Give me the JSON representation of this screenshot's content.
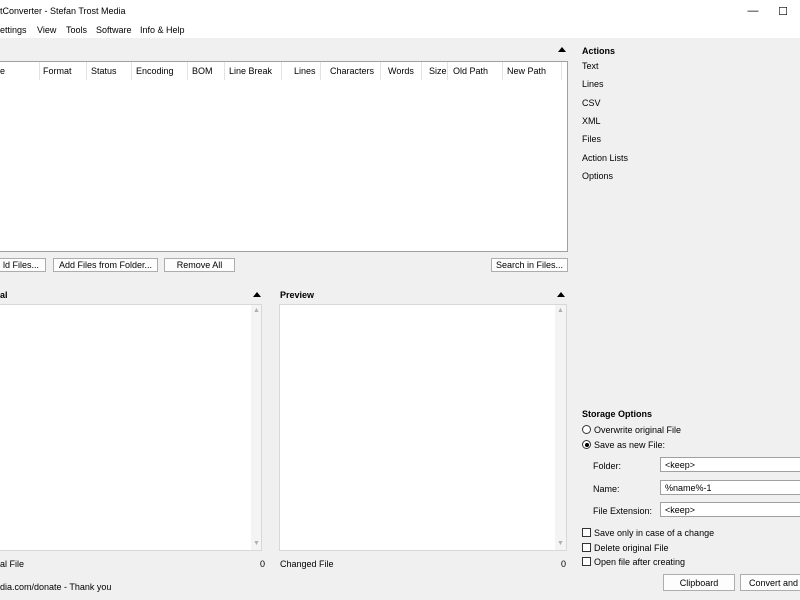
{
  "window": {
    "title": "tConverter - Stefan Trost Media",
    "minimize_icon": "—",
    "maximize_icon": "☐"
  },
  "menu": [
    "ettings",
    "View",
    "Tools",
    "Software",
    "Info & Help"
  ],
  "file_list": {
    "columns": [
      "e",
      "Format",
      "Status",
      "Encoding",
      "BOM",
      "Line Break",
      "Lines",
      "Characters",
      "Words",
      "Size",
      "Old Path",
      "New Path"
    ]
  },
  "file_buttons": {
    "add_files": "ld Files...",
    "add_from_folder": "Add Files from Folder...",
    "remove_all": "Remove All",
    "search_in_files": "Search in Files..."
  },
  "panes": {
    "original_title": "al",
    "preview_title": "Preview",
    "original_footer": "al File",
    "original_count": "0",
    "changed_footer": "Changed File",
    "changed_count": "0"
  },
  "actions": {
    "title": "Actions",
    "items": [
      "Text",
      "Lines",
      "CSV",
      "XML",
      "Files",
      "Action Lists",
      "Options"
    ]
  },
  "storage": {
    "title": "Storage Options",
    "overwrite_label": "Overwrite original File",
    "save_new_label": "Save as new File:",
    "selected": "save_new",
    "folder_label": "Folder:",
    "folder_value": "<keep>",
    "name_label": "Name:",
    "name_value": "%name%-1",
    "extension_label": "File Extension:",
    "extension_value": "<keep>",
    "save_only_change": "Save only in case of a change",
    "delete_original": "Delete original File",
    "open_after": "Open file after creating"
  },
  "bottom": {
    "status_text": "dia.com/donate - Thank you",
    "clipboard": "Clipboard",
    "convert": "Convert and S"
  }
}
